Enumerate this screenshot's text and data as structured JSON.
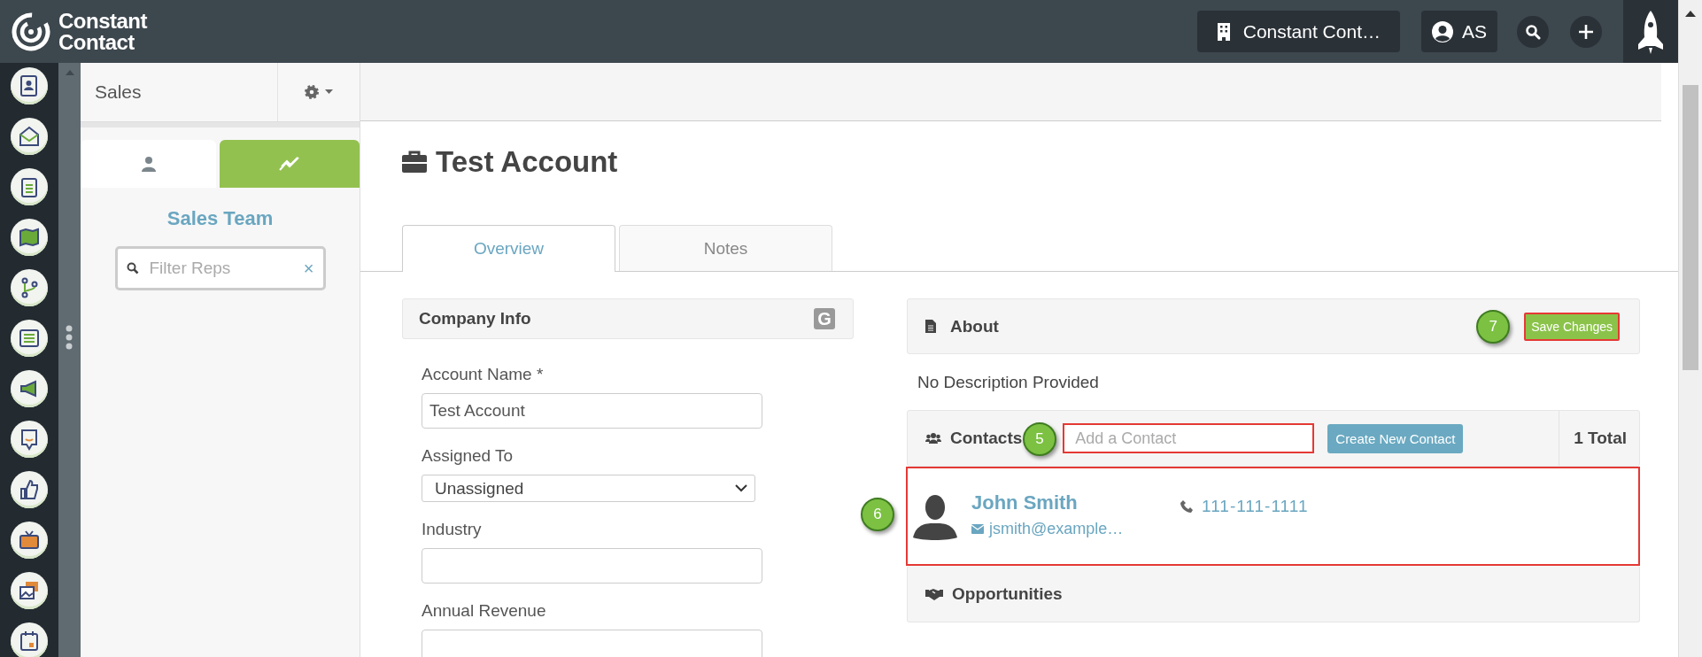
{
  "brand": {
    "line1": "Constant",
    "line2": "Contact"
  },
  "top_bar": {
    "account": "Constant Cont…",
    "user": "AS"
  },
  "sidebar": {
    "title": "Sales",
    "tabs": [
      {
        "kind": "person",
        "selected": true
      },
      {
        "kind": "chart",
        "selected": false
      }
    ],
    "heading": "Sales Team",
    "filter": {
      "placeholder": "Filter Reps",
      "clear": "×"
    }
  },
  "page": {
    "title": "Test Account",
    "tabs": [
      {
        "label": "Overview",
        "selected": true
      },
      {
        "label": "Notes",
        "selected": false
      }
    ]
  },
  "company_info": {
    "title": "Company Info",
    "badge": "G",
    "fields": [
      {
        "label": "Account Name *",
        "kind": "text",
        "value": "Test Account"
      },
      {
        "label": "Assigned To",
        "kind": "select",
        "value": "Unassigned"
      },
      {
        "label": "Industry",
        "kind": "text"
      },
      {
        "label": "Annual Revenue",
        "kind": "text"
      }
    ]
  },
  "about": {
    "title": "About",
    "description": "No Description Provided",
    "save_button": "Save Changes",
    "save_callout": "7",
    "save_highlighted": true
  },
  "contacts": {
    "title": "Contacts",
    "search": {
      "placeholder": "Add a Contact",
      "callout": "5",
      "highlighted": true
    },
    "create_button": "Create New Contact",
    "total": "1 Total",
    "items": [
      {
        "name": "John Smith",
        "email": "jsmith@example…",
        "phone": "111-111-1111",
        "callout": "6",
        "highlighted": true
      }
    ]
  },
  "opportunities": {
    "title": "Opportunities"
  }
}
